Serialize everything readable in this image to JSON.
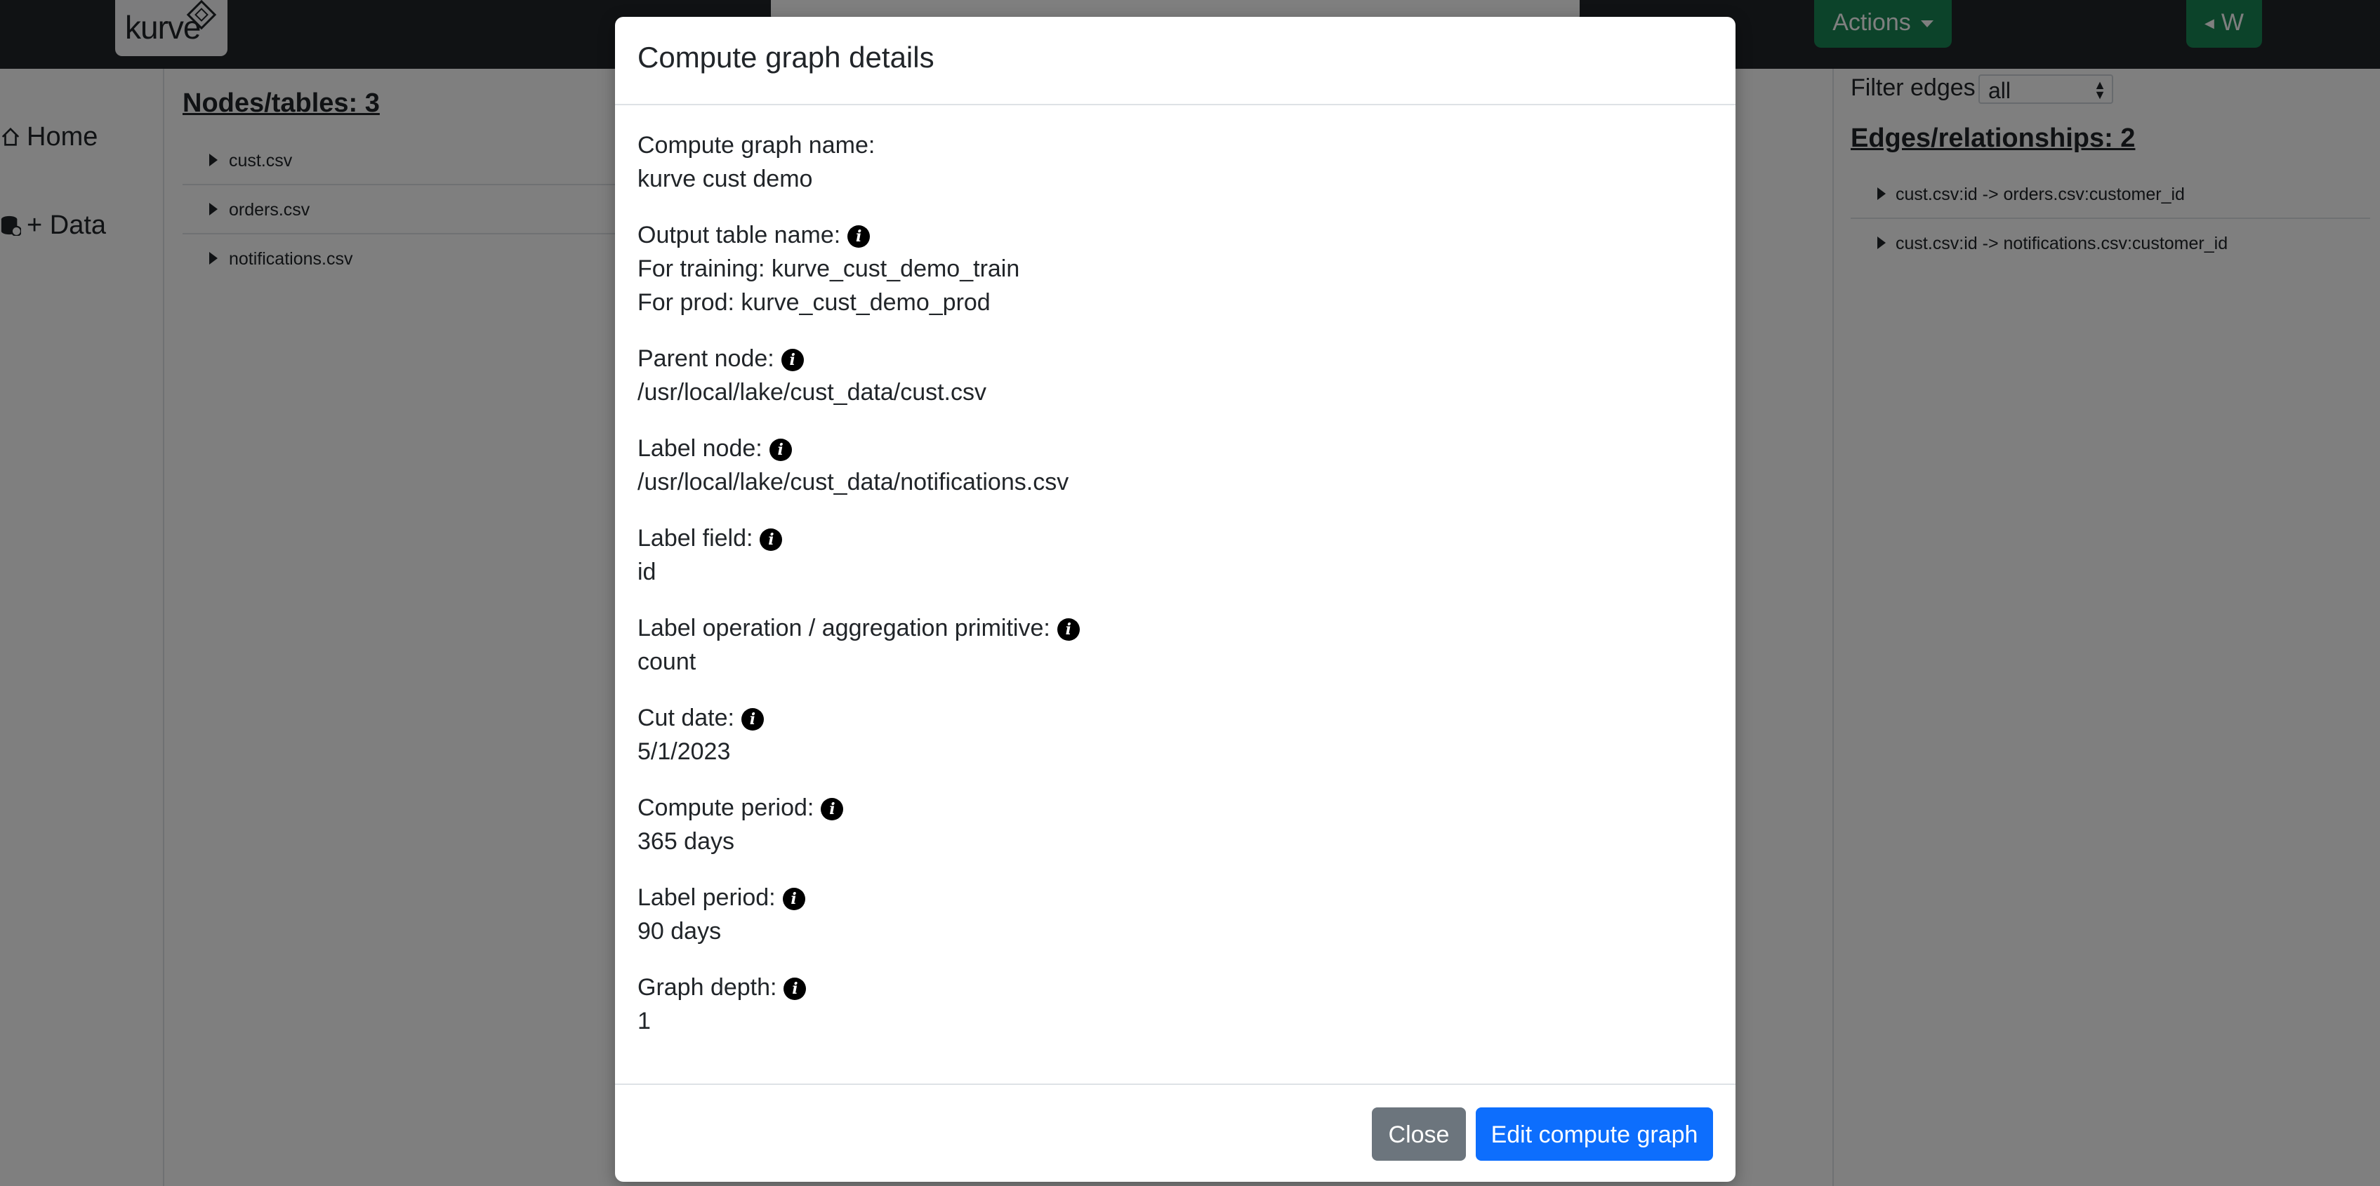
{
  "app": {
    "logo_text": "kurve"
  },
  "topbar": {
    "actions_label": "Actions",
    "w_label": "W"
  },
  "sidebar": {
    "items": [
      {
        "label": "Home"
      },
      {
        "label": "+ Data"
      }
    ]
  },
  "nodes": {
    "title": "Nodes/tables: 3",
    "items": [
      {
        "label": "cust.csv"
      },
      {
        "label": "orders.csv"
      },
      {
        "label": "notifications.csv"
      }
    ]
  },
  "edges": {
    "filter_label": "Filter edges",
    "filter_value": "all",
    "title": "Edges/relationships: 2",
    "items": [
      {
        "label": "cust.csv:id -> orders.csv:customer_id"
      },
      {
        "label": "cust.csv:id -> notifications.csv:customer_id"
      }
    ]
  },
  "modal": {
    "title": "Compute graph details",
    "compute_graph_name_label": "Compute graph name:",
    "compute_graph_name": "kurve cust demo",
    "output_table_label": "Output table name:",
    "output_training": "For training: kurve_cust_demo_train",
    "output_prod": "For prod: kurve_cust_demo_prod",
    "parent_node_label": "Parent node:",
    "parent_node": "/usr/local/lake/cust_data/cust.csv",
    "label_node_label": "Label node:",
    "label_node": "/usr/local/lake/cust_data/notifications.csv",
    "label_field_label": "Label field:",
    "label_field": "id",
    "label_operation_label": "Label operation / aggregation primitive:",
    "label_operation": "count",
    "cut_date_label": "Cut date:",
    "cut_date": "5/1/2023",
    "compute_period_label": "Compute period:",
    "compute_period": "365 days",
    "label_period_label": "Label period:",
    "label_period": "90 days",
    "graph_depth_label": "Graph depth:",
    "graph_depth": "1",
    "info_glyph": "i",
    "close_label": "Close",
    "edit_label": "Edit compute graph"
  }
}
